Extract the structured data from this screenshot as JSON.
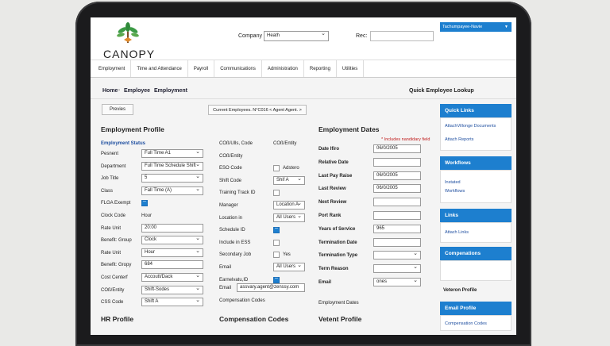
{
  "header": {
    "logo_text": "CANOPY",
    "company_label": "Company",
    "company_value": "Heath",
    "rec_label": "Rec:",
    "rec_value": "",
    "user_menu": "Tachumpayee-Navie"
  },
  "nav": {
    "items": [
      "Employment",
      "Time and Attendance",
      "Payroll",
      "Communications",
      "Administration",
      "Reporting",
      "Utilities"
    ]
  },
  "breadcrumb": {
    "items": [
      "Home",
      "Employee",
      "Employment"
    ],
    "quick_lookup": "Quick Employee Lookup"
  },
  "toolbar": {
    "previous_label": "Previes",
    "current_label": "Current Employees. N°C016  < Agent Agent. >"
  },
  "employment_profile": {
    "title": "Employment Profile",
    "status_title": "Employment Status",
    "rows": [
      {
        "label": "Pesnent",
        "value": "Full Time A1",
        "kind": "select"
      },
      {
        "label": "Department",
        "value": "Full Time Schedule Shift",
        "kind": "select"
      },
      {
        "label": "Job Title",
        "value": "5",
        "kind": "select"
      },
      {
        "label": "Class",
        "value": "Fall Time (A)",
        "kind": "select"
      },
      {
        "label": "FLGA Exempt",
        "value": "",
        "kind": "check"
      },
      {
        "label": "Clock Code",
        "value": "Hour",
        "kind": "text"
      },
      {
        "label": "Rate Unit",
        "value": "20:00",
        "kind": "input"
      },
      {
        "label": "Benefit: Group",
        "value": "Clock",
        "kind": "select"
      },
      {
        "label": "Rate Unit",
        "value": "Hour",
        "kind": "select"
      },
      {
        "label": "Benefit: Gropy",
        "value": "684",
        "kind": "input"
      },
      {
        "label": "Cost Centerf",
        "value": "Accoutt/Dack",
        "kind": "select"
      },
      {
        "label": "COß/Entity",
        "value": "Shift-Sodes",
        "kind": "select"
      },
      {
        "label": "CSS Code",
        "value": "Shift A",
        "kind": "select"
      }
    ]
  },
  "middle": {
    "rows": [
      {
        "label": "COß/Ulls, Code",
        "value": "COß/Entity",
        "kind": "text"
      },
      {
        "label": "COß/Entity",
        "value": "",
        "kind": "text"
      },
      {
        "label": "ESO Code",
        "value": "Adstero",
        "kind": "check-off"
      },
      {
        "label": "Shift Code",
        "value": "Shif A",
        "kind": "select"
      },
      {
        "label": "Training Track ID",
        "value": "",
        "kind": "check-off"
      },
      {
        "label": "Manager",
        "value": "Location A",
        "kind": "select"
      },
      {
        "label": "Location in",
        "value": "All Users",
        "kind": "select"
      },
      {
        "label": "Schedule ID",
        "value": "",
        "kind": "check"
      },
      {
        "label": "Include in ESS",
        "value": "",
        "kind": "check-off"
      },
      {
        "label": "Secondary Job",
        "value": "Yes",
        "kind": "check-off"
      },
      {
        "label": "Email",
        "value": "All Users",
        "kind": "select"
      },
      {
        "label": "Earnelvatu,ID",
        "value": "",
        "kind": "check"
      }
    ],
    "email_label": "Email",
    "email_value": "assvary.agent@zenssy.com",
    "comp_codes_label": "Compensation Codes"
  },
  "employment_dates": {
    "title": "Employment Dates",
    "note": "* Includes nandidary field",
    "rows": [
      {
        "label": "Date Ifiro",
        "value": "06/0/2005",
        "kind": "input"
      },
      {
        "label": "Relative Date",
        "value": "",
        "kind": "input"
      },
      {
        "label": "Last Pay Raise",
        "value": "06/0/2005",
        "kind": "input"
      },
      {
        "label": "Last Review",
        "value": "06/0/2005",
        "kind": "input"
      },
      {
        "label": "Next Review",
        "value": "",
        "kind": "input"
      },
      {
        "label": "Port Rank",
        "value": "",
        "kind": "input"
      },
      {
        "label": "Years of Service",
        "value": "965",
        "kind": "input"
      },
      {
        "label": "Termination Date",
        "value": "",
        "kind": "input"
      },
      {
        "label": "Termination Type",
        "value": "",
        "kind": "select"
      },
      {
        "label": "Term Reason",
        "value": "",
        "kind": "select"
      },
      {
        "label": "Email",
        "value": "ones",
        "kind": "select"
      }
    ],
    "footer_label": "Employment Dates"
  },
  "sidebar": {
    "quick_links_title": "Quick Links",
    "quick_links": [
      "AttachVillonge Documents",
      "Attach Reports"
    ],
    "workflows_title": "Workflows",
    "workflows_items": [
      "Instated",
      "Workflows"
    ],
    "links_title": "Links",
    "links_items": [
      "Attach Links"
    ],
    "compensations_title": "Compenations",
    "veteran_profile": "Veteron Profile",
    "email_profile_title": "Email Profile",
    "compensation_codes": "Compensation Codes"
  },
  "bottom": {
    "hr_profile": "HR Profile",
    "compensation_codes": "Compensation Codes",
    "vetent_profile": "Vetent Profile"
  },
  "colors": {
    "accent": "#1d7fcf",
    "required_note": "#c01b1b"
  }
}
